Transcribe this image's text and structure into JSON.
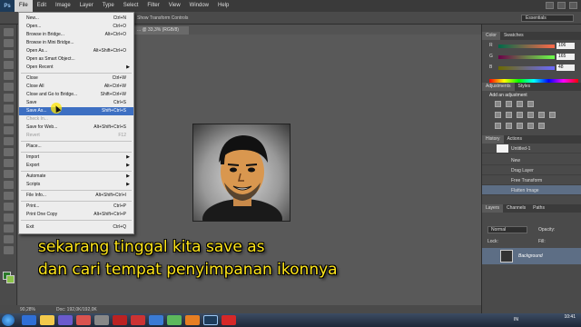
{
  "menubar": {
    "logo": "Ps",
    "items": [
      "File",
      "Edit",
      "Image",
      "Layer",
      "Type",
      "Select",
      "Filter",
      "View",
      "Window",
      "Help"
    ]
  },
  "options_bar": {
    "label": "Show Transform Controls",
    "workspace": "Essentials"
  },
  "document_tab": {
    "title": "... @ 33,3% (RGB/8)"
  },
  "status_bar": {
    "zoom": "90,28%",
    "doc_size": "Doc: 192,0K/192,0K"
  },
  "file_menu": {
    "items": [
      {
        "label": "New...",
        "shortcut": "Ctrl+N"
      },
      {
        "label": "Open...",
        "shortcut": "Ctrl+O"
      },
      {
        "label": "Browse in Bridge...",
        "shortcut": "Alt+Ctrl+O"
      },
      {
        "label": "Browse in Mini Bridge...",
        "shortcut": ""
      },
      {
        "label": "Open As...",
        "shortcut": "Alt+Shift+Ctrl+O"
      },
      {
        "label": "Open as Smart Object...",
        "shortcut": ""
      },
      {
        "label": "Open Recent",
        "shortcut": ""
      },
      {
        "label": "Close",
        "shortcut": "Ctrl+W"
      },
      {
        "label": "Close All",
        "shortcut": "Alt+Ctrl+W"
      },
      {
        "label": "Close and Go to Bridge...",
        "shortcut": "Shift+Ctrl+W"
      },
      {
        "label": "Save",
        "shortcut": "Ctrl+S"
      },
      {
        "label": "Save As...",
        "shortcut": "Shift+Ctrl+S"
      },
      {
        "label": "Check In...",
        "shortcut": ""
      },
      {
        "label": "Save for Web...",
        "shortcut": "Alt+Shift+Ctrl+S"
      },
      {
        "label": "Revert",
        "shortcut": "F12"
      },
      {
        "label": "Place...",
        "shortcut": ""
      },
      {
        "label": "Import",
        "shortcut": ""
      },
      {
        "label": "Export",
        "shortcut": ""
      },
      {
        "label": "Automate",
        "shortcut": ""
      },
      {
        "label": "Scripts",
        "shortcut": ""
      },
      {
        "label": "File Info...",
        "shortcut": "Alt+Shift+Ctrl+I"
      },
      {
        "label": "Print...",
        "shortcut": "Ctrl+P"
      },
      {
        "label": "Print One Copy",
        "shortcut": "Alt+Shift+Ctrl+P"
      },
      {
        "label": "Exit",
        "shortcut": "Ctrl+Q"
      }
    ]
  },
  "color_panel": {
    "tabs": [
      "Color",
      "Swatches"
    ],
    "channels": [
      {
        "label": "R",
        "value": "106"
      },
      {
        "label": "G",
        "value": "165"
      },
      {
        "label": "B",
        "value": "48"
      }
    ]
  },
  "adjustments_panel": {
    "tabs": [
      "Adjustments",
      "Styles"
    ],
    "title": "Add an adjustment"
  },
  "history_panel": {
    "tabs": [
      "History",
      "Actions"
    ],
    "snapshot": "Untitled-1",
    "states": [
      "New",
      "Drag Layer",
      "Free Transform",
      "Flatten Image"
    ]
  },
  "layers_panel": {
    "tabs": [
      "Layers",
      "Channels",
      "Paths"
    ],
    "blend_mode": "Normal",
    "opacity_label": "Opacity:",
    "lock_label": "Lock:",
    "fill_label": "Fill:",
    "layer_name": "Background"
  },
  "subtitle": {
    "line1": "sekarang tinggal kita save as",
    "line2": "dan cari tempat penyimpanan ikonnya"
  },
  "taskbar": {
    "lang": "IN",
    "time": "10:41"
  },
  "colors": {
    "accent": "#3d6fc2",
    "subtitle": "#ffe61a"
  }
}
